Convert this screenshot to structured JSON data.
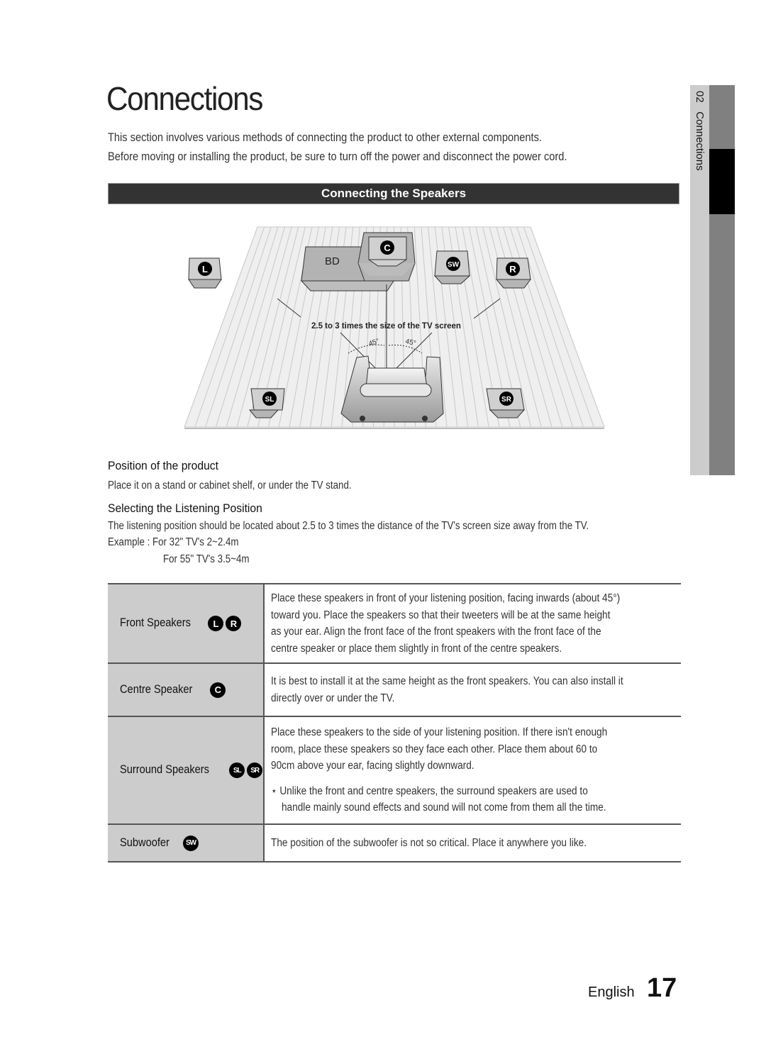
{
  "page": {
    "title": "Connections",
    "intro_lines": [
      "This section involves various methods of connecting the product to other external components.",
      "Before moving or installing the product, be sure to turn off the power and disconnect the power cord."
    ],
    "section_header": "Connecting the Speakers"
  },
  "diagram": {
    "speaker_badges": {
      "L": "L",
      "C": "C",
      "SW": "SW",
      "R": "R",
      "SL": "SL",
      "SR": "SR"
    },
    "device_label": "BD",
    "distance_label": "2.5 to 3 times the size of the TV screen",
    "angle_left": "45°",
    "angle_right": "45°",
    "colors": {
      "floor": "#efefef",
      "floor_lines": "#c8c8c8",
      "speaker_face": "#d0d0d0",
      "speaker_body": "#b3b3b3",
      "badge": "#000000"
    }
  },
  "position": {
    "heading": "Position of the product",
    "text": "Place it on a stand or cabinet shelf, or under the TV stand."
  },
  "listening": {
    "heading": "Selecting the Listening Position",
    "text": "The listening position should be located about 2.5 to 3 times the distance of the TV's screen size away from the TV.",
    "example_1": "Example : For 32\" TV's 2~2.4m",
    "example_2": "For 55\" TV's 3.5~4m"
  },
  "table": {
    "rows": [
      {
        "label": "Front Speakers",
        "badges": [
          "L",
          "R"
        ],
        "lines": [
          "Place these speakers in front of your listening position, facing inwards (about 45°)",
          "toward you. Place the speakers so that their tweeters will be at the same height",
          "as your ear. Align the front face of the front speakers with the front face of the",
          "centre speaker or place them slightly in front of the centre speakers."
        ]
      },
      {
        "label": "Centre Speaker",
        "badges": [
          "C"
        ],
        "lines": [
          "It is best to install it at the same height as the front speakers. You can also install it",
          "directly over or under the TV."
        ]
      },
      {
        "label": "Surround Speakers",
        "badges": [
          "SL",
          "SR"
        ],
        "lines": [
          "Place these speakers to the side of your listening position. If there isn't enough",
          "room, place these speakers so they face each other. Place them about 60 to",
          "90cm above your ear, facing slightly downward."
        ],
        "note_lines": [
          "⋆ Unlike the front and centre speakers, the surround speakers are used to",
          "handle mainly sound effects and sound will not come from them all the time."
        ]
      },
      {
        "label": "Subwoofer",
        "badges": [
          "SW"
        ],
        "lines": [
          "The position of the subwoofer is not so critical. Place it anywhere you like."
        ]
      }
    ]
  },
  "sidebar": {
    "chapter_number": "02",
    "chapter_title": "Connections"
  },
  "footer": {
    "language": "English",
    "page_number": "17"
  }
}
